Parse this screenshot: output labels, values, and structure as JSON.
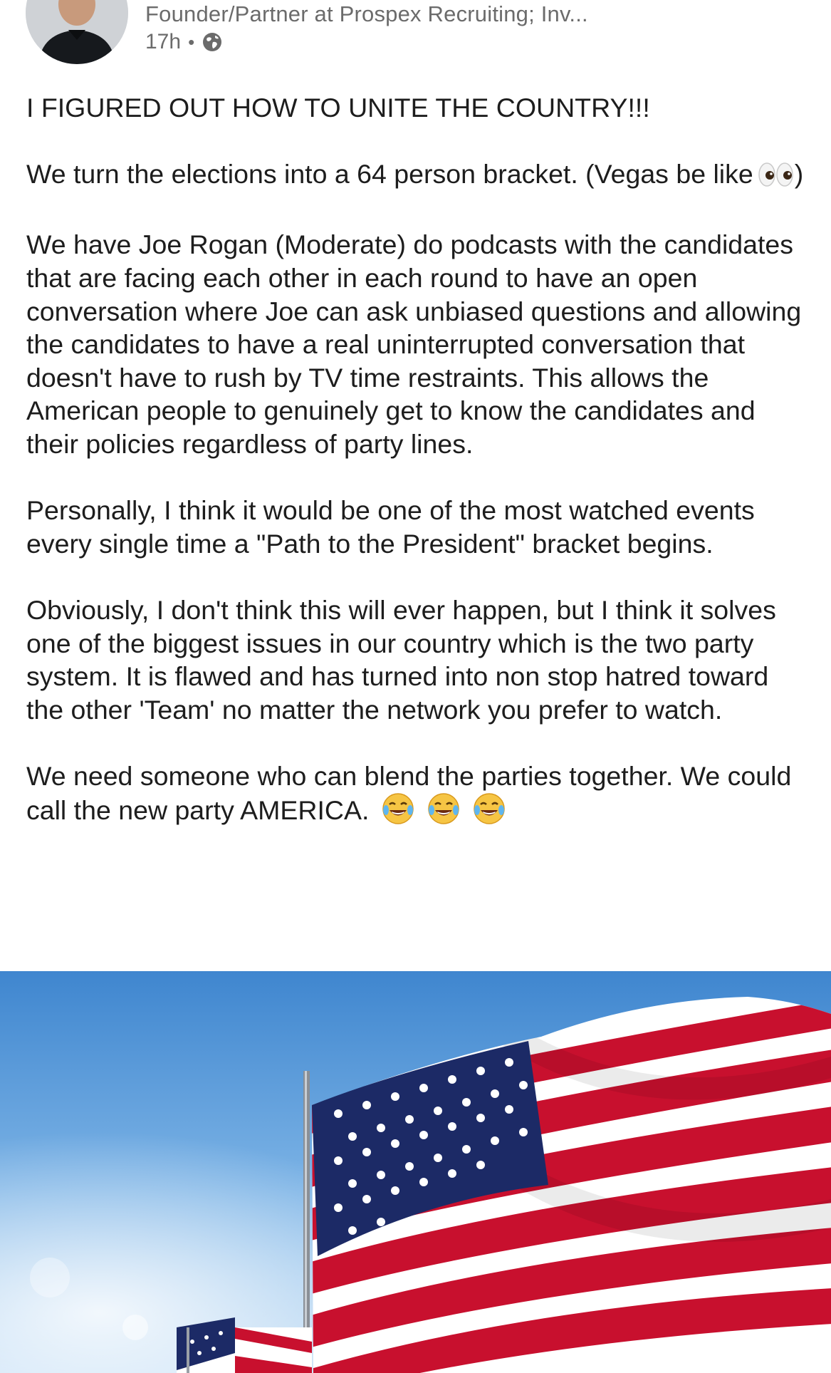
{
  "post": {
    "author_headline": "Founder/Partner at Prospex Recruiting; Inv...",
    "timestamp": "17h",
    "separator": "•",
    "visibility_icon": "globe-icon",
    "paragraphs": [
      "I FIGURED OUT HOW TO UNITE THE COUNTRY!!!",
      "We turn the elections into a 64 person bracket. (Vegas be like",
      "We have Joe Rogan (Moderate) do podcasts with the candidates that are facing each other in each round to have an open conversation where Joe can ask unbiased questions and allowing the candidates to have a real uninterrupted conversation that doesn't have to rush by TV time restraints. This allows the American people to genuinely get to know the candidates and their policies regardless of party lines.",
      "Personally, I think it would be one of the most watched events every single time a \"Path to the President\" bracket begins.",
      "Obviously, I don't think this will ever happen, but I think it solves one of the biggest issues in our country which is the two party system. It is flawed and has turned into non stop hatred toward the other 'Team' no matter the network you prefer to watch.",
      "We need someone who can blend the parties together. We could call the new party AMERICA."
    ],
    "paragraph_2_suffix": ")",
    "emojis": [
      "eyes-emoji",
      "laughing-tears-emoji"
    ],
    "image_icon": "american-flag-photo"
  },
  "colors": {
    "text": "#1d1d1d",
    "meta": "#6b6b6b",
    "sky": "#6aa5dc",
    "flag_red": "#c8102e",
    "flag_blue": "#1c2a66"
  }
}
